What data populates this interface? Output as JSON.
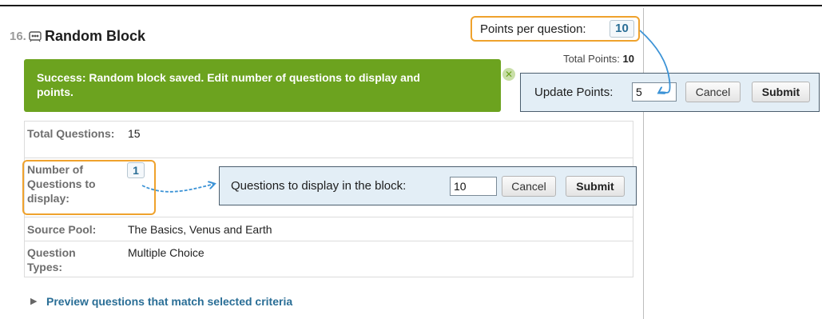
{
  "question": {
    "number": "16.",
    "title": "Random Block"
  },
  "points": {
    "per_question_label": "Points per question:",
    "per_question_value": "10",
    "total_label": "Total Points:",
    "total_value": "10"
  },
  "success": {
    "message": "Success: Random block saved. Edit number of questions to display and points."
  },
  "update_points": {
    "label": "Update Points:",
    "input_value": "5",
    "cancel_label": "Cancel",
    "submit_label": "Submit"
  },
  "details": {
    "total_questions_label": "Total Questions:",
    "total_questions_value": "15",
    "num_display_label": "Number of Questions to display:",
    "num_display_value": "1",
    "source_pool_label": "Source Pool:",
    "source_pool_value": "The Basics, Venus and Earth",
    "question_types_label": "Question Types:",
    "question_types_value": "Multiple Choice"
  },
  "display_editor": {
    "label": "Questions to display in the block:",
    "input_value": "10",
    "cancel_label": "Cancel",
    "submit_label": "Submit"
  },
  "preview": {
    "link_text": "Preview questions that match selected criteria"
  },
  "colors": {
    "highlight_orange": "#efa22d",
    "success_green": "#6ca31f",
    "link_blue": "#2a6e96",
    "callout_arrow_blue": "#3c93d6",
    "editor_bg": "#e3eef6"
  },
  "icons": {
    "random_block": "random-block-icon",
    "close": "close-icon",
    "expand": "triangle-right-icon"
  }
}
